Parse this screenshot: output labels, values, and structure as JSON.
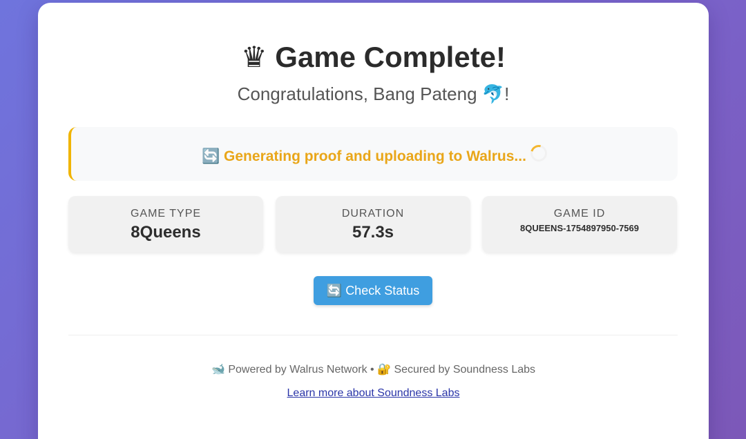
{
  "header": {
    "title_icon": "♛",
    "title": "Game Complete!",
    "subtitle_prefix": "Congratulations, ",
    "player_name": "Bang Pateng",
    "player_emoji": "🐬",
    "subtitle_suffix": "!"
  },
  "status": {
    "icon": "🔄",
    "text": "Generating proof and uploading to Walrus...",
    "color": "#e9a619"
  },
  "stats": [
    {
      "label": "GAME TYPE",
      "value": "8Queens"
    },
    {
      "label": "DURATION",
      "value": "57.3s"
    },
    {
      "label": "GAME ID",
      "value": "8QUEENS-1754897950-7569"
    }
  ],
  "actions": {
    "check_status_icon": "🔄",
    "check_status_label": "Check Status"
  },
  "footer": {
    "walrus_icon": "🐋",
    "walrus_text": "Powered by Walrus Network",
    "separator": "•",
    "lock_icon": "🔐",
    "secured_text": "Secured by Soundness Labs",
    "link_text": "Learn more about Soundness Labs"
  },
  "colors": {
    "accent": "#3f9ee0",
    "status_border": "#f0b400"
  }
}
